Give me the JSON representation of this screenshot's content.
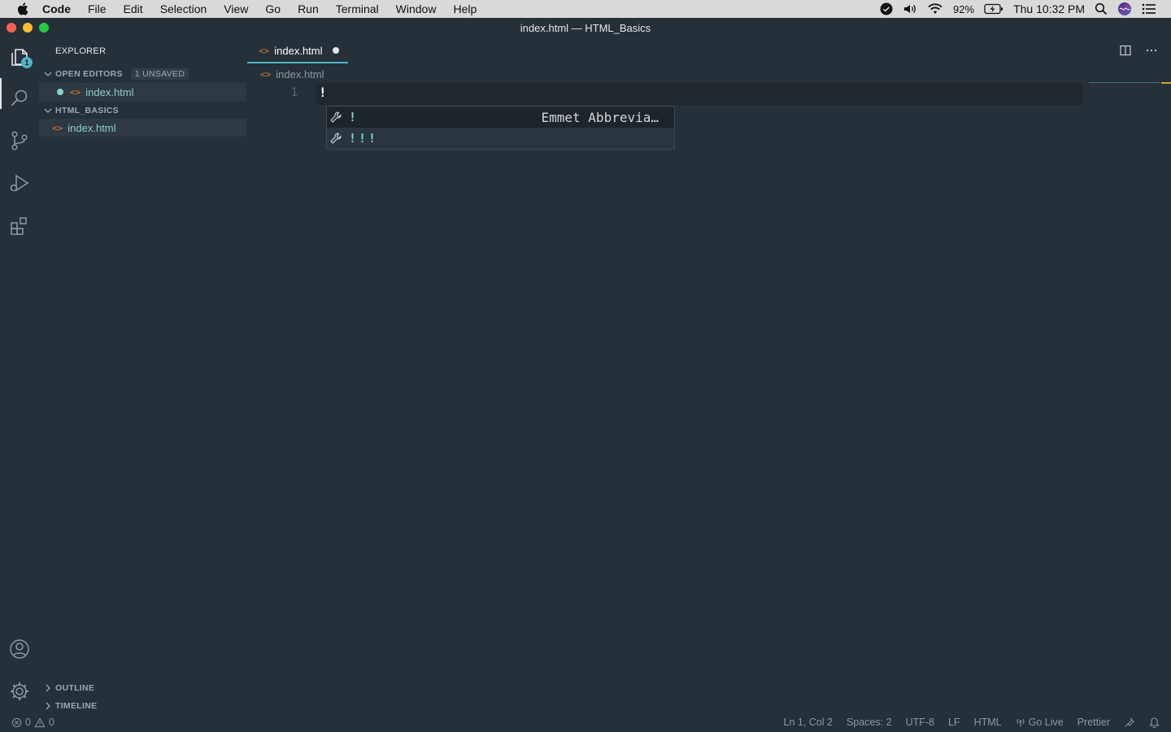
{
  "menubar": {
    "items": [
      "Code",
      "File",
      "Edit",
      "Selection",
      "View",
      "Go",
      "Run",
      "Terminal",
      "Window",
      "Help"
    ],
    "battery": "92%",
    "clock": "Thu 10:32 PM"
  },
  "window": {
    "title": "index.html — HTML_Basics"
  },
  "activity": {
    "explorer_badge": "1"
  },
  "sidebar": {
    "title": "EXPLORER",
    "open_editors": {
      "label": "OPEN EDITORS",
      "unsaved": "1 UNSAVED",
      "file": "index.html"
    },
    "folder": {
      "label": "HTML_BASICS",
      "file": "index.html"
    },
    "outline": "OUTLINE",
    "timeline": "TIMELINE"
  },
  "editor": {
    "tab_label": "index.html",
    "breadcrumb": "index.html",
    "line_number": "1",
    "line_text": "!",
    "suggestions": [
      {
        "label": "!",
        "detail": "Emmet Abbrevia…",
        "selected": true
      },
      {
        "label": "!!!",
        "detail": "",
        "selected": false
      }
    ]
  },
  "statusbar": {
    "errors": "0",
    "warnings": "0",
    "position": "Ln 1, Col 2",
    "spaces": "Spaces: 2",
    "encoding": "UTF-8",
    "eol": "LF",
    "language": "HTML",
    "golive": "Go Live",
    "prettier": "Prettier"
  },
  "colors": {
    "accent": "#4fb3c4",
    "modified": "#8ad1c2",
    "html_icon": "#e37933",
    "background": "#263039"
  }
}
